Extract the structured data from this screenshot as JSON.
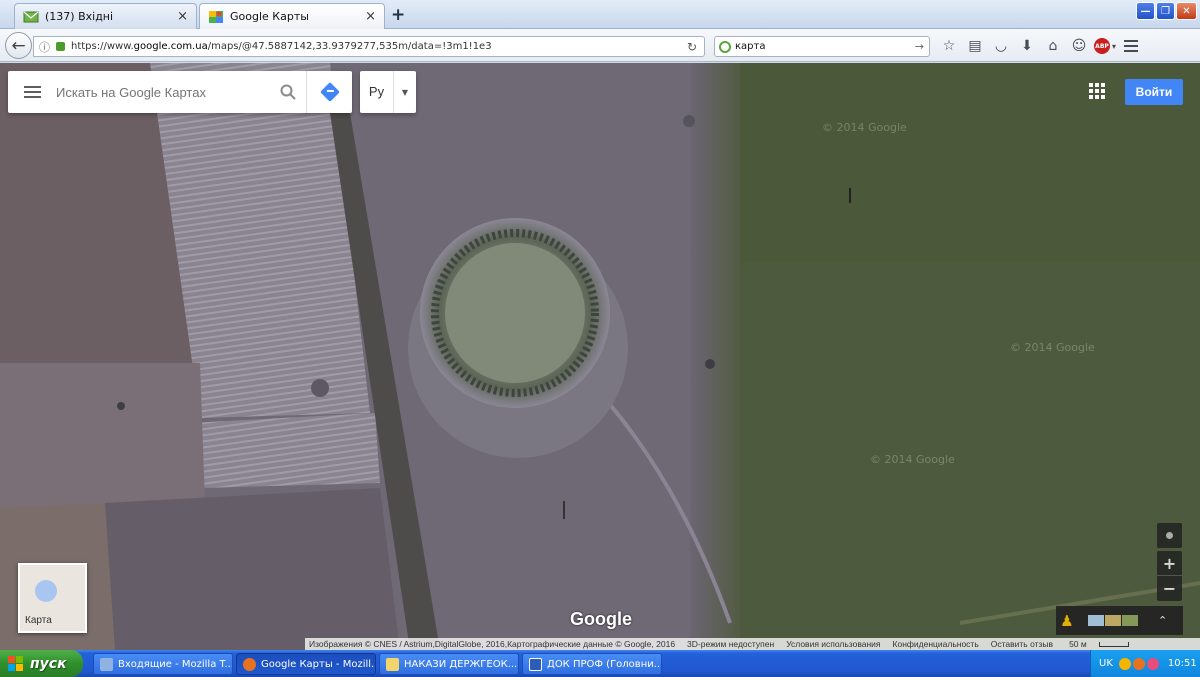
{
  "browser": {
    "tabs": [
      {
        "label": "(137) Вхідні",
        "active": false
      },
      {
        "label": "Google Карты",
        "active": true
      }
    ],
    "new_tab_glyph": "+",
    "tab_close_glyph": "×",
    "url_prefix": "https://www.",
    "url_host": "google.com.ua",
    "url_rest": "/maps/@47.5887142,33.9379277,535m/data=!3m1!1e3",
    "search_value": "карта"
  },
  "maps": {
    "search_placeholder": "Искать на Google Картах",
    "language_label": "Ру",
    "signin_label": "Войти",
    "minimap_label": "Карта",
    "logo_text": "Google",
    "watermark": "© 2014 Google",
    "attribution": {
      "imagery": "Изображения © CNES / Astrium,DigitalGlobe, 2016,Картографические данные © Google, 2016",
      "mode_3d": "3D-режим недоступен",
      "terms": "Условия использования",
      "privacy": "Конфиденциальность",
      "feedback": "Оставить отзыв",
      "scale": "50 м"
    },
    "colors": {
      "accent": "#4285f4"
    }
  },
  "taskbar": {
    "start_label": "пуск",
    "tasks": [
      {
        "label": "Входящие - Mozilla T...",
        "icon": "thunderbird-icon",
        "active": false
      },
      {
        "label": "Google Карты - Mozill...",
        "icon": "firefox-icon",
        "active": true
      },
      {
        "label": "НАКАЗИ ДЕРЖГЕОК...",
        "icon": "folder-icon",
        "active": false
      },
      {
        "label": "ДОК ПРОФ (Головни...",
        "icon": "word-icon",
        "active": false
      }
    ],
    "tray_lang": "UK",
    "clock": "10:51"
  }
}
